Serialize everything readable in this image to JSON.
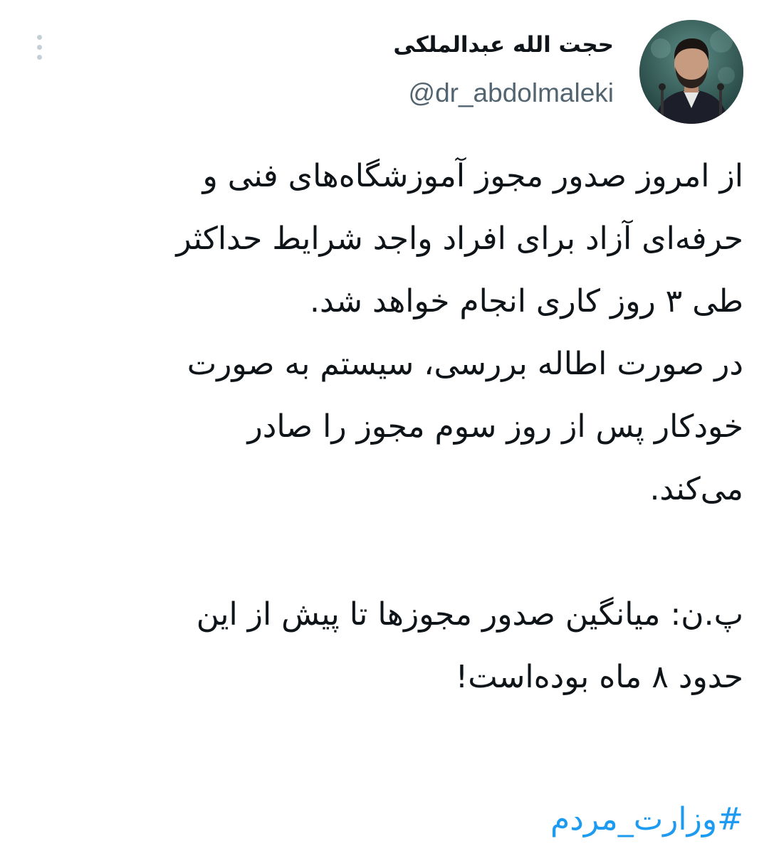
{
  "author": {
    "name": "حجت الله عبدالملکی",
    "handle": "@dr_abdolmaleki"
  },
  "tweet": {
    "paragraph1": [
      "از امروز صدور مجوز آموزشگاه‌های فنی و",
      "حرفه‌ای آزاد برای افراد واجد شرایط حداکثر",
      "طی ۳ روز کاری انجام خواهد شد."
    ],
    "paragraph2": [
      "در صورت اطاله بررسی، سیستم به صورت",
      "خودکار پس از روز سوم مجوز را صادر",
      "می‌کند."
    ],
    "paragraph3": [
      "پ.ن: میانگین صدور مجوزها تا پیش از این",
      "حدود ۸ ماه بوده‌است!"
    ],
    "hashtag": "#وزارت_مردم"
  },
  "icons": {
    "more": "more-vertical-icon",
    "avatar": "profile-photo"
  },
  "colors": {
    "text": "#0f1419",
    "handle": "#536471",
    "link": "#1d9bf0",
    "more_dots": "#c4cfd6",
    "background": "#ffffff"
  }
}
